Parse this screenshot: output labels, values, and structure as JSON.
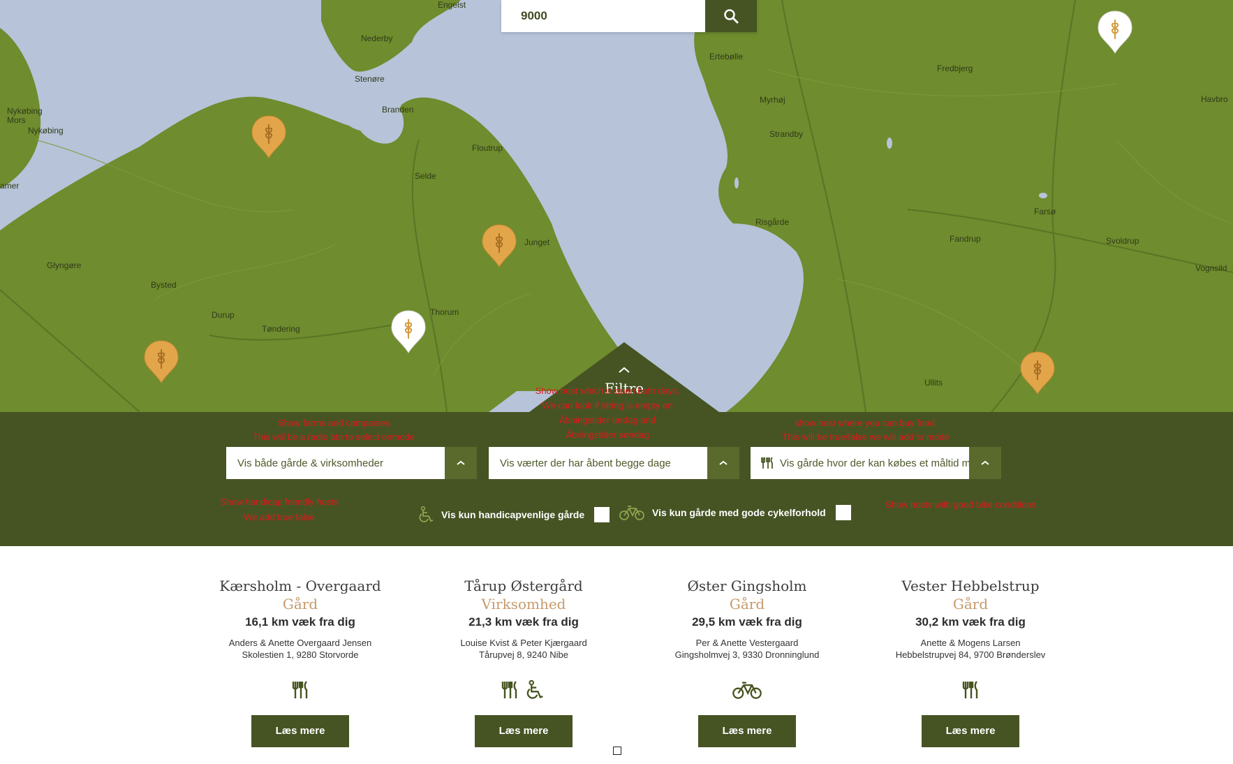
{
  "search": {
    "value": "9000",
    "button_icon": "search-icon"
  },
  "map": {
    "places": [
      "Engelst",
      "Nederby",
      "Stenøre",
      "Branden",
      "Nykøbing Mors",
      "Nykøbing",
      "Floutrup",
      "Selde",
      "Junget",
      "Glyngøre",
      "Bysted",
      "Durup",
      "Tøndering",
      "Thorum",
      "Ertebølle",
      "Fredbjerg",
      "Havbro",
      "Myrhøj",
      "Strandby",
      "Risgårde",
      "Farsø",
      "Fandrup",
      "Svoldrup",
      "Vognsild",
      "Ullits",
      "amer"
    ],
    "pins": [
      {
        "color": "orange",
        "icon": "wheat-icon"
      },
      {
        "color": "orange",
        "icon": "wheat-icon"
      },
      {
        "color": "white",
        "icon": "wheat-icon"
      },
      {
        "color": "orange",
        "icon": "wheat-icon"
      },
      {
        "color": "white",
        "icon": "wheat-icon"
      },
      {
        "color": "orange",
        "icon": "wheat-icon"
      }
    ]
  },
  "filter": {
    "tab_label": "Filtre",
    "notes": {
      "farms_1": "Show farms and companies",
      "farms_2": "This will be a radio btn to select onmode",
      "days_1": "Show host which is open both days.",
      "days_2": "We can look if string is empty on",
      "days_3": "Åbningstider lørdag and",
      "days_4": "Åbningstider søndag",
      "food_1": "show host where you can buy food.",
      "food_2": "This will be true/false we will add to mode",
      "handicap_1": "Show handicap friendly hosts",
      "handicap_2": "We add true false",
      "bike": "Show hosts with good bike conditions"
    },
    "select_type": "Vis både gårde & virksomheder",
    "select_days": "Vis værter der har åbent begge dage",
    "select_food": "Vis gårde hvor der kan købes et måltid mad",
    "check_handicap": "Vis kun handicapvenlige gårde",
    "check_bike": "Vis kun gårde med gode cykelforhold"
  },
  "results": [
    {
      "name": "Kærsholm - Overgaard",
      "type": "Gård",
      "distance": "16,1 km væk fra dig",
      "owner": "Anders & Anette Overgaard Jensen",
      "address": "Skolestien 1, 9280 Storvorde",
      "icons": [
        "cutlery-icon"
      ],
      "button": "Læs mere"
    },
    {
      "name": "Tårup Østergård",
      "type": "Virksomhed",
      "distance": "21,3 km væk fra dig",
      "owner": "Louise Kvist & Peter Kjærgaard",
      "address": "Tårupvej 8, 9240 Nibe",
      "icons": [
        "cutlery-icon",
        "wheelchair-icon"
      ],
      "button": "Læs mere"
    },
    {
      "name": "Øster Gingsholm",
      "type": "Gård",
      "distance": "29,5 km væk fra dig",
      "owner": "Per & Anette Vestergaard",
      "address": "Gingsholmvej 3, 9330 Dronninglund",
      "icons": [
        "bicycle-icon"
      ],
      "button": "Læs mere"
    },
    {
      "name": "Vester Hebbelstrup",
      "type": "Gård",
      "distance": "30,2 km væk fra dig",
      "owner": "Anette & Mogens Larsen",
      "address": "Hebbelstrupvej 84, 9700 Brønderslev",
      "icons": [
        "cutlery-icon"
      ],
      "button": "Læs mere"
    }
  ],
  "colors": {
    "dark_green": "#465424",
    "map_green": "#6f8c2e",
    "water": "#b7c3d9",
    "pin_orange": "#e3a54a",
    "note_red": "#e0191b",
    "type_tan": "#c59a6b"
  }
}
